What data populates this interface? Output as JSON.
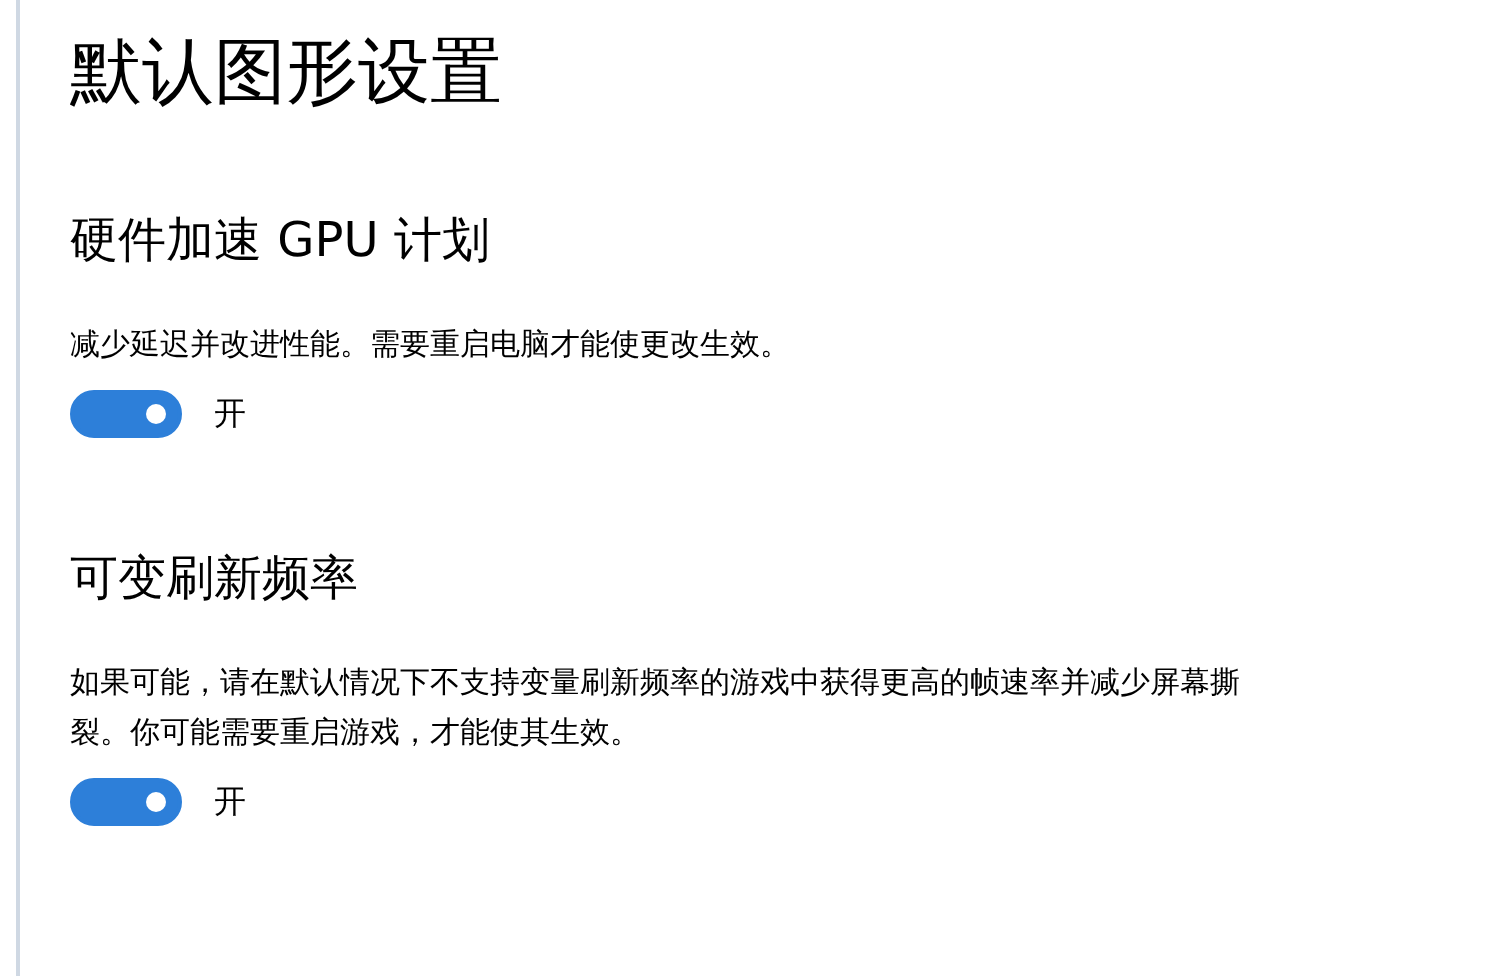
{
  "title": "默认图形设置",
  "sections": [
    {
      "heading": "硬件加速 GPU 计划",
      "description": "减少延迟并改进性能。需要重启电脑才能使更改生效。",
      "toggle": {
        "on": true,
        "label": "开"
      }
    },
    {
      "heading": "可变刷新频率",
      "description": "如果可能，请在默认情况下不支持变量刷新频率的游戏中获得更高的帧速率并减少屏幕撕裂。你可能需要重启游戏，才能使其生效。",
      "toggle": {
        "on": true,
        "label": "开"
      }
    }
  ]
}
